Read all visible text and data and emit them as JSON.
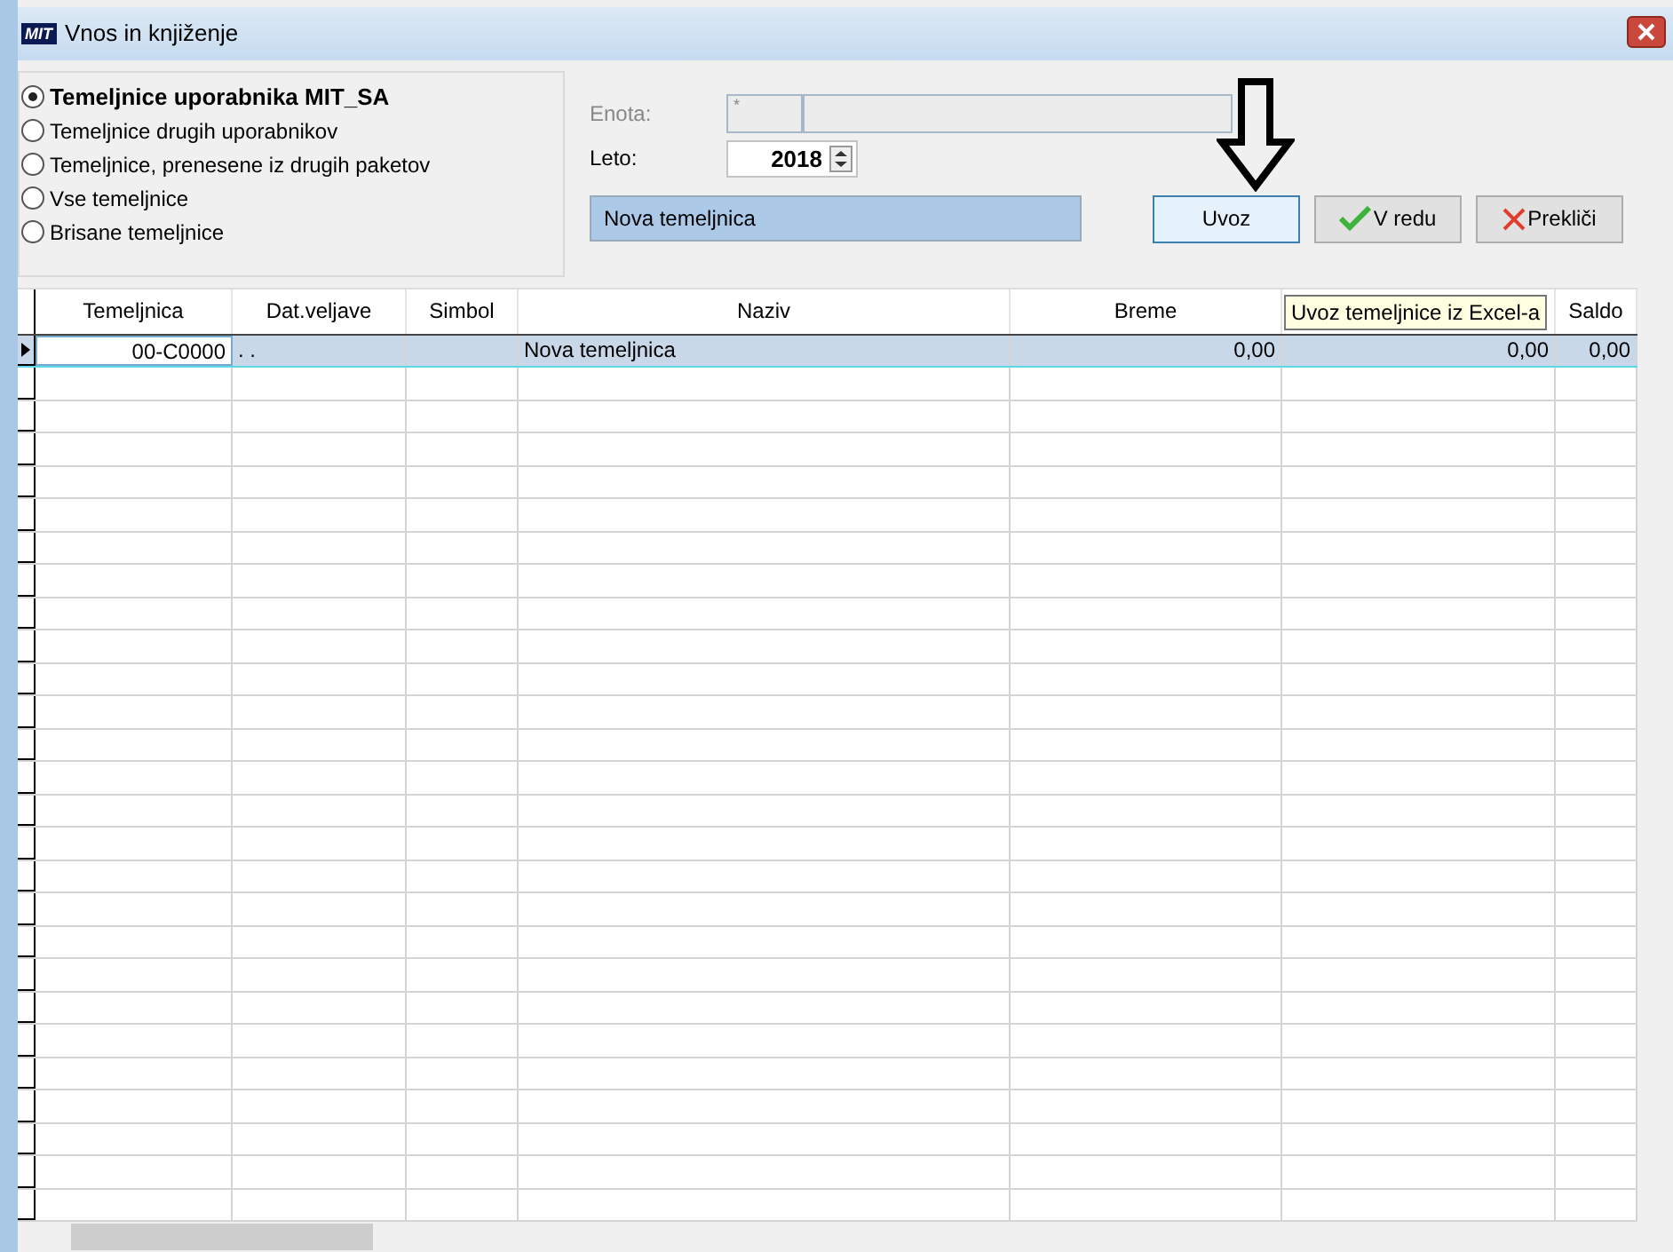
{
  "window": {
    "title": "Vnos in knjiženje",
    "logo": "MIT"
  },
  "filters": [
    {
      "label": "Temeljnice uporabnika MIT_SA",
      "selected": true
    },
    {
      "label": "Temeljnice drugih uporabnikov",
      "selected": false
    },
    {
      "label": "Temeljnice, prenesene iz drugih paketov",
      "selected": false
    },
    {
      "label": "Vse temeljnice",
      "selected": false
    },
    {
      "label": "Brisane temeljnice",
      "selected": false
    }
  ],
  "enota": {
    "label": "Enota:",
    "value": "*",
    "disabled": true
  },
  "leto": {
    "label": "Leto:",
    "value": "2018"
  },
  "status_text": "Nova temeljnica",
  "buttons": [
    {
      "kind": "import",
      "label": "Uvoz"
    },
    {
      "kind": "ok",
      "label": "V redu"
    },
    {
      "kind": "cancel",
      "label": "Prekliči"
    }
  ],
  "tooltip": "Uvoz temeljnice iz Excel-a",
  "table": {
    "columns": [
      {
        "label": "Temeljnica"
      },
      {
        "label": "Dat.veljave"
      },
      {
        "label": "Simbol"
      },
      {
        "label": "Naziv"
      },
      {
        "label": "Breme"
      },
      {},
      {
        "label": "Saldo"
      }
    ],
    "rows": [
      {
        "selected": true,
        "cells": [
          "00-C0000",
          ". .",
          "",
          "Nova temeljnica",
          "0,00",
          "0,00",
          "0,00"
        ]
      }
    ]
  }
}
